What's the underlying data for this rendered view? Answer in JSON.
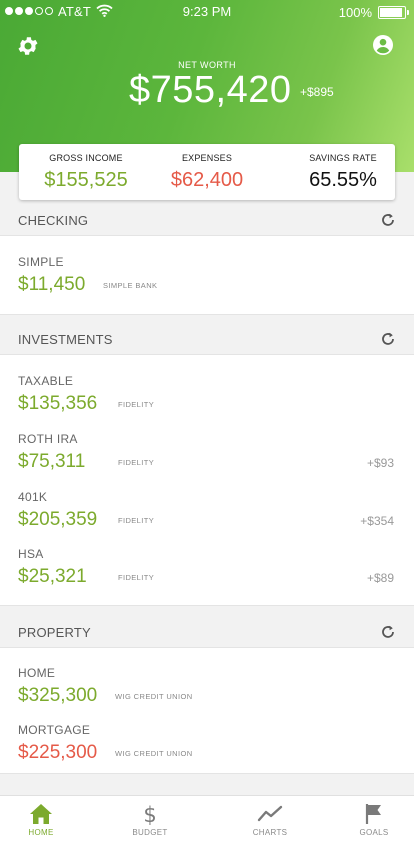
{
  "status_bar": {
    "carrier": "AT&T",
    "time": "9:23 PM",
    "battery": "100%"
  },
  "header": {
    "net_worth_label": "NET WORTH",
    "net_worth_value": "$755,420",
    "net_worth_change": "+$895"
  },
  "summary": {
    "gross_income_label": "GROSS INCOME",
    "gross_income_value": "$155,525",
    "expenses_label": "EXPENSES",
    "expenses_value": "$62,400",
    "savings_rate_label": "SAVINGS RATE",
    "savings_rate_value": "65.55%"
  },
  "sections": {
    "checking": {
      "title": "CHECKING",
      "accounts": [
        {
          "name": "SIMPLE",
          "amount": "$11,450",
          "institution": "SIMPLE BANK"
        }
      ]
    },
    "investments": {
      "title": "INVESTMENTS",
      "accounts": [
        {
          "name": "TAXABLE",
          "amount": "$135,356",
          "institution": "FIDELITY",
          "change": ""
        },
        {
          "name": "ROTH IRA",
          "amount": "$75,311",
          "institution": "FIDELITY",
          "change": "+$93"
        },
        {
          "name": "401K",
          "amount": "$205,359",
          "institution": "FIDELITY",
          "change": "+$354"
        },
        {
          "name": "HSA",
          "amount": "$25,321",
          "institution": "FIDELITY",
          "change": "+$89"
        }
      ]
    },
    "property": {
      "title": "PROPERTY",
      "accounts": [
        {
          "name": "HOME",
          "amount": "$325,300",
          "institution": "WIG CREDIT UNION"
        },
        {
          "name": "MORTGAGE",
          "amount": "$225,300",
          "institution": "WIG CREDIT UNION"
        }
      ]
    }
  },
  "tabs": [
    {
      "label": "HOME",
      "icon": "home-icon",
      "active": true
    },
    {
      "label": "BUDGET",
      "icon": "dollar-icon",
      "active": false
    },
    {
      "label": "CHARTS",
      "icon": "line-chart-icon",
      "active": false
    },
    {
      "label": "GOALS",
      "icon": "flag-icon",
      "active": false
    }
  ],
  "colors": {
    "brand_green": "#5cb63c",
    "positive": "#7caa2d",
    "negative": "#e55a48"
  }
}
